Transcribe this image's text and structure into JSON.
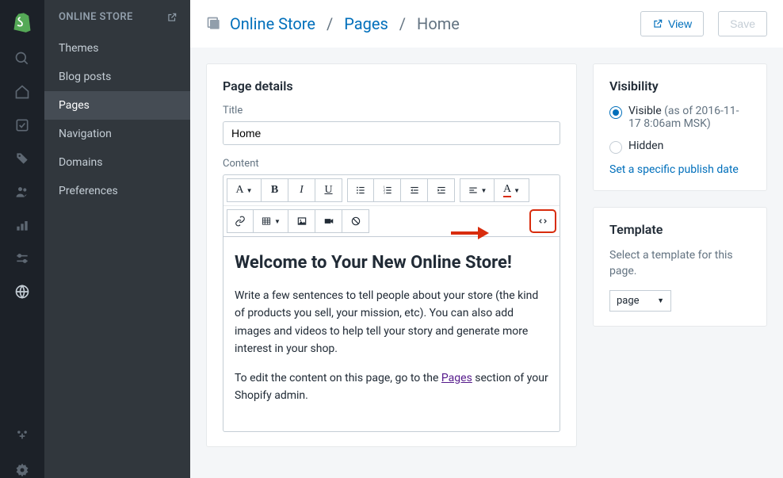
{
  "sidebar": {
    "header": "ONLINE STORE",
    "items": [
      "Themes",
      "Blog posts",
      "Pages",
      "Navigation",
      "Domains",
      "Preferences"
    ],
    "activeIndex": 2
  },
  "breadcrumb": {
    "root": "Online Store",
    "section": "Pages",
    "current": "Home"
  },
  "actions": {
    "view": "View",
    "save": "Save"
  },
  "pageDetails": {
    "heading": "Page details",
    "titleLabel": "Title",
    "titleValue": "Home",
    "contentLabel": "Content"
  },
  "editorContent": {
    "heading": "Welcome to Your New Online Store!",
    "p1": "Write a few sentences to tell people about your store (the kind of products you sell, your mission, etc). You can also add images and videos to help tell your story and generate more interest in your shop.",
    "p2a": "To edit the content on this page, go to the ",
    "p2link": "Pages",
    "p2b": " section of your Shopify admin."
  },
  "visibility": {
    "heading": "Visibility",
    "visibleLabel": "Visible",
    "visibleNote": "(as of 2016-11-17 8:06am MSK)",
    "hiddenLabel": "Hidden",
    "publishLink": "Set a specific publish date"
  },
  "template": {
    "heading": "Template",
    "description": "Select a template for this page.",
    "selected": "page"
  }
}
